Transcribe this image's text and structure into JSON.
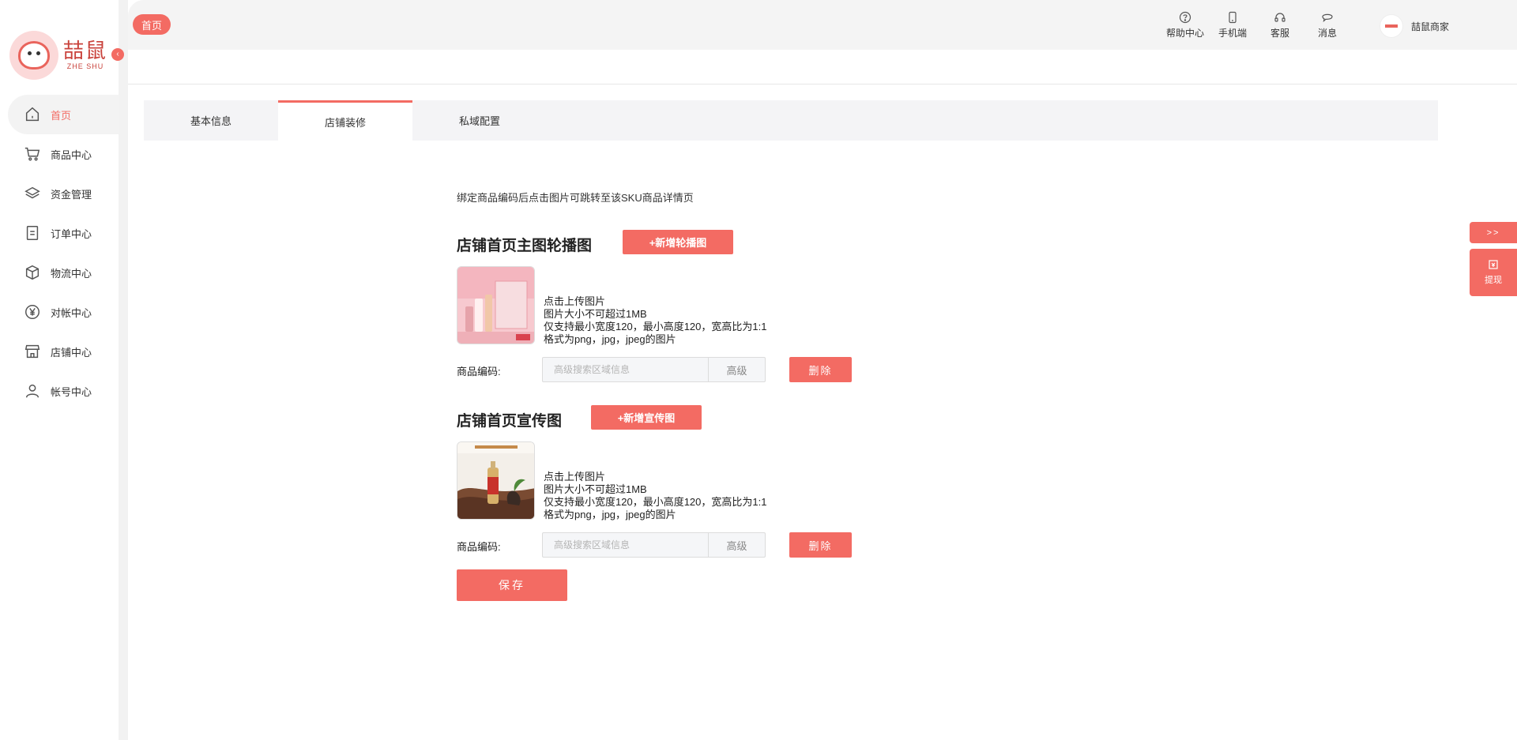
{
  "app": {
    "logo_text": "喆鼠",
    "logo_subtext": "ZHE SHU"
  },
  "sidebar": {
    "items": [
      {
        "label": "首页",
        "icon": "home-icon",
        "active": true
      },
      {
        "label": "商品中心",
        "icon": "cart-icon",
        "active": false
      },
      {
        "label": "资金管理",
        "icon": "layers-icon",
        "active": false
      },
      {
        "label": "订单中心",
        "icon": "order-icon",
        "active": false
      },
      {
        "label": "物流中心",
        "icon": "box-icon",
        "active": false
      },
      {
        "label": "对帐中心",
        "icon": "yen-icon",
        "active": false
      },
      {
        "label": "店铺中心",
        "icon": "store-icon",
        "active": false
      },
      {
        "label": "帐号中心",
        "icon": "user-icon",
        "active": false
      }
    ]
  },
  "header": {
    "breadcrumb_tag": "首页",
    "actions": [
      {
        "label": "帮助中心",
        "icon": "help-icon"
      },
      {
        "label": "手机端",
        "icon": "mobile-icon"
      },
      {
        "label": "客服",
        "icon": "headset-icon"
      },
      {
        "label": "消息",
        "icon": "message-icon"
      }
    ],
    "merchant_name": "喆鼠商家"
  },
  "tabs": [
    {
      "label": "基本信息",
      "active": false
    },
    {
      "label": "店铺装修",
      "active": true
    },
    {
      "label": "私域配置",
      "active": false
    }
  ],
  "content": {
    "hint": "绑定商品编码后点击图片可跳转至该SKU商品详情页",
    "sections": [
      {
        "title": "店铺首页主图轮播图",
        "add_label": "+新增轮播图",
        "upload_lines": [
          "点击上传图片",
          "图片大小不可超过1MB",
          "仅支持最小宽度120，最小高度120，宽高比为1:1",
          "格式为png，jpg，jpeg的图片"
        ],
        "code_label": "商品编码:",
        "search_placeholder": "高级搜索区域信息",
        "advanced_label": "高级",
        "delete_label": "删除"
      },
      {
        "title": "店铺首页宣传图",
        "add_label": "+新增宣传图",
        "upload_lines": [
          "点击上传图片",
          "图片大小不可超过1MB",
          "仅支持最小宽度120，最小高度120，宽高比为1:1",
          "格式为png，jpg，jpeg的图片"
        ],
        "code_label": "商品编码:",
        "search_placeholder": "高级搜索区域信息",
        "advanced_label": "高级",
        "delete_label": "删除"
      }
    ],
    "save_label": "保存"
  },
  "floaters": {
    "toggle_label": ">>",
    "withdraw_label": "提现"
  },
  "colors": {
    "accent": "#f36b63",
    "tab_bar": "#f4f4f6",
    "header_bg": "#f4f4f4"
  }
}
